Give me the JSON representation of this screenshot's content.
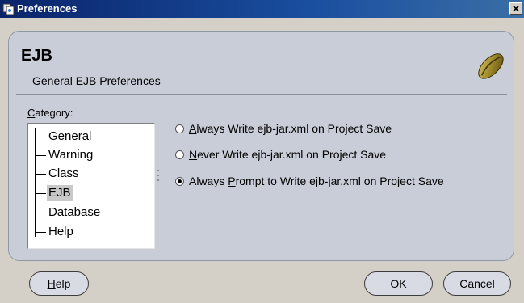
{
  "window": {
    "title": "Preferences",
    "close_label": "✕"
  },
  "header": {
    "title": "EJB",
    "subtitle": "General EJB Preferences"
  },
  "category": {
    "label_accel": "C",
    "label_rest": "ategory:",
    "items": [
      {
        "label": "General",
        "selected": false
      },
      {
        "label": "Warning",
        "selected": false
      },
      {
        "label": "Class",
        "selected": false
      },
      {
        "label": "EJB",
        "selected": true
      },
      {
        "label": "Database",
        "selected": false
      },
      {
        "label": "Help",
        "selected": false
      }
    ]
  },
  "options": [
    {
      "accel": "A",
      "rest": "lways Write ejb-jar.xml on Project Save",
      "checked": false
    },
    {
      "accel": "N",
      "rest": "ever Write ejb-jar.xml on Project Save",
      "checked": false
    },
    {
      "prefix": "Always ",
      "accel": "P",
      "rest": "rompt to Write ejb-jar.xml on Project Save",
      "checked": true
    }
  ],
  "buttons": {
    "help_accel": "H",
    "help_rest": "elp",
    "ok": "OK",
    "cancel": "Cancel"
  },
  "colors": {
    "titlebar": "#0a246a",
    "panel": "#c9cdd8",
    "dialog_bg": "#d4d0c8"
  }
}
